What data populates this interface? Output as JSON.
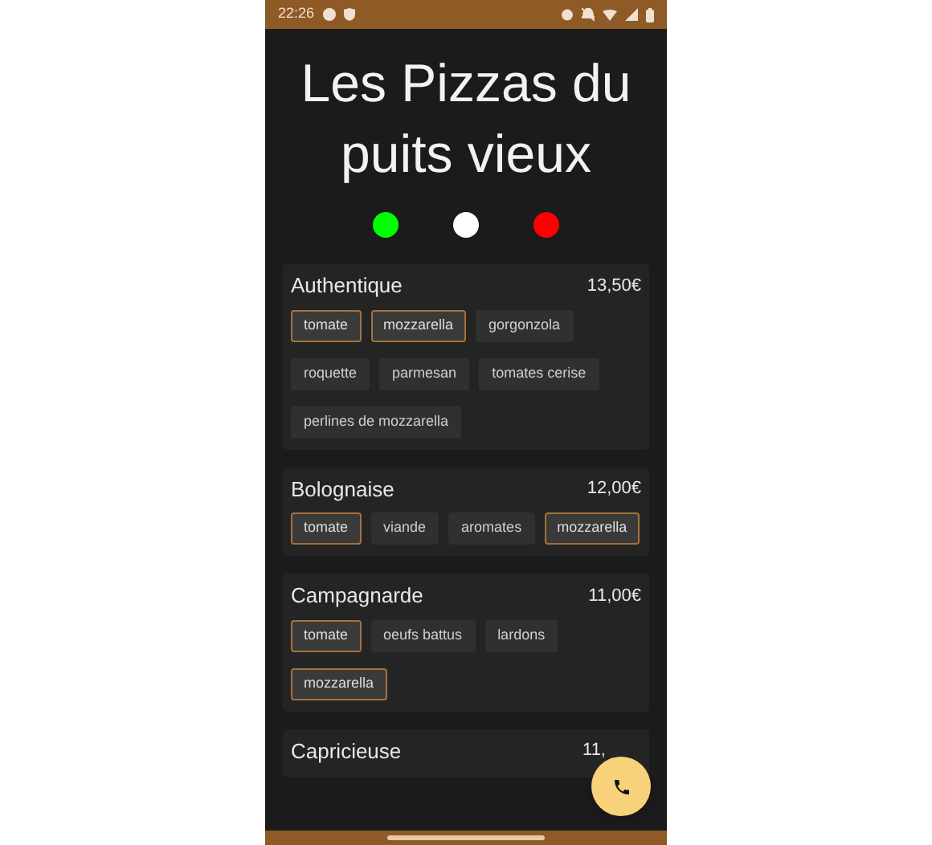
{
  "status_bar": {
    "time": "22:26"
  },
  "title": "Les Pizzas du puits vieux",
  "filters": [
    {
      "color": "#00ff00"
    },
    {
      "color": "#ffffff"
    },
    {
      "color": "#ff0000"
    }
  ],
  "pizzas": [
    {
      "name": "Authentique",
      "price": "13,50€",
      "ingredients": [
        {
          "label": "tomate",
          "selected": true
        },
        {
          "label": "mozzarella",
          "selected": true
        },
        {
          "label": "gorgonzola",
          "selected": false
        },
        {
          "label": "roquette",
          "selected": false
        },
        {
          "label": "parmesan",
          "selected": false
        },
        {
          "label": "tomates cerise",
          "selected": false
        },
        {
          "label": "perlines de mozzarella",
          "selected": false
        }
      ]
    },
    {
      "name": "Bolognaise",
      "price": "12,00€",
      "ingredients": [
        {
          "label": "tomate",
          "selected": true
        },
        {
          "label": "viande",
          "selected": false
        },
        {
          "label": "aromates",
          "selected": false
        },
        {
          "label": "mozzarella",
          "selected": true
        }
      ]
    },
    {
      "name": "Campagnarde",
      "price": "11,00€",
      "ingredients": [
        {
          "label": "tomate",
          "selected": true
        },
        {
          "label": "oeufs battus",
          "selected": false
        },
        {
          "label": "lardons",
          "selected": false
        },
        {
          "label": "mozzarella",
          "selected": true
        }
      ]
    },
    {
      "name": "Capricieuse",
      "price": "11,"
    }
  ]
}
